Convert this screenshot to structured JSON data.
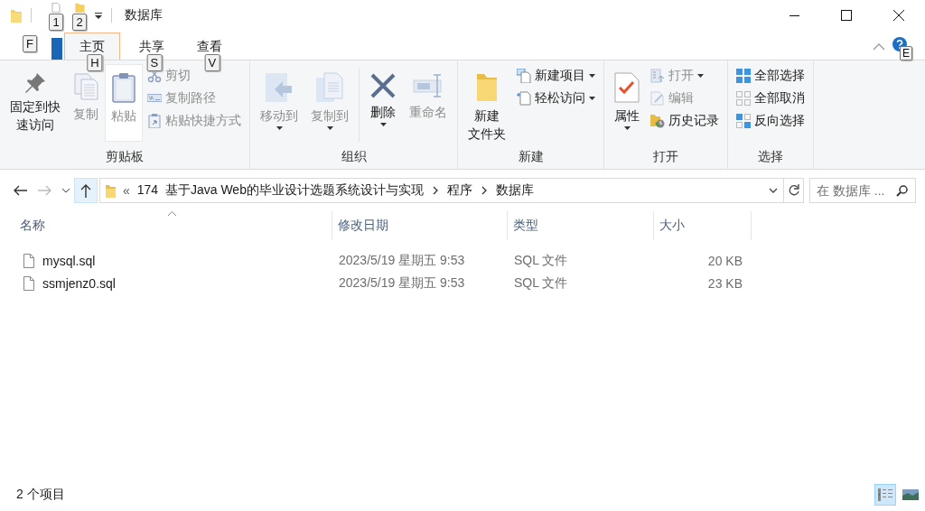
{
  "window": {
    "title": "数据库",
    "quick_access_keytips": [
      "1",
      "2"
    ]
  },
  "file_tab": {
    "keytip": "F"
  },
  "tabs": [
    {
      "label": "主页",
      "selected": true,
      "keytip": "H"
    },
    {
      "label": "共享",
      "selected": false,
      "keytip": "S"
    },
    {
      "label": "查看",
      "selected": false,
      "keytip": "V"
    }
  ],
  "help": {
    "keytip": "E"
  },
  "ribbon_groups": [
    {
      "label": "剪贴板",
      "items": [
        {
          "kind": "large",
          "lines": [
            "固定到快",
            "速访问"
          ],
          "disabled": false,
          "dropdown": false
        },
        {
          "kind": "large",
          "lines": [
            "复制"
          ],
          "disabled": true,
          "dropdown": false
        },
        {
          "kind": "large",
          "lines": [
            "粘贴"
          ],
          "disabled": true,
          "dropdown": false,
          "hovered": true
        },
        {
          "kind": "small",
          "lines": [
            "剪切"
          ],
          "disabled": true,
          "dropdown": false
        },
        {
          "kind": "small",
          "lines": [
            "复制路径"
          ],
          "disabled": true,
          "dropdown": false
        },
        {
          "kind": "small",
          "lines": [
            "粘贴快捷方式"
          ],
          "disabled": true,
          "dropdown": false
        }
      ]
    },
    {
      "label": "组织",
      "items": [
        {
          "kind": "large",
          "lines": [
            "移动到"
          ],
          "disabled": true,
          "dropdown": true
        },
        {
          "kind": "large",
          "lines": [
            "复制到"
          ],
          "disabled": true,
          "dropdown": true
        },
        {
          "kind": "large",
          "lines": [
            "删除"
          ],
          "disabled": false,
          "dropdown": true,
          "separator_before": true
        },
        {
          "kind": "large",
          "lines": [
            "重命名"
          ],
          "disabled": true,
          "dropdown": false
        }
      ]
    },
    {
      "label": "新建",
      "items": [
        {
          "kind": "large",
          "lines": [
            "新建",
            "文件夹"
          ],
          "disabled": false,
          "dropdown": false
        },
        {
          "kind": "small",
          "lines": [
            "新建项目"
          ],
          "disabled": false,
          "dropdown": true
        },
        {
          "kind": "small",
          "lines": [
            "轻松访问"
          ],
          "disabled": false,
          "dropdown": true
        }
      ]
    },
    {
      "label": "打开",
      "items": [
        {
          "kind": "large",
          "lines": [
            "属性"
          ],
          "disabled": false,
          "dropdown": true
        },
        {
          "kind": "small",
          "lines": [
            "打开"
          ],
          "disabled": true,
          "dropdown": true
        },
        {
          "kind": "small",
          "lines": [
            "编辑"
          ],
          "disabled": true,
          "dropdown": false
        },
        {
          "kind": "small",
          "lines": [
            "历史记录"
          ],
          "disabled": false,
          "dropdown": false
        }
      ]
    },
    {
      "label": "选择",
      "items": [
        {
          "kind": "small",
          "lines": [
            "全部选择"
          ],
          "disabled": false,
          "dropdown": false
        },
        {
          "kind": "small",
          "lines": [
            "全部取消"
          ],
          "disabled": false,
          "dropdown": false
        },
        {
          "kind": "small",
          "lines": [
            "反向选择"
          ],
          "disabled": false,
          "dropdown": false
        }
      ]
    }
  ],
  "navigation": {
    "back_disabled": false,
    "forward_disabled": true,
    "up_hovered": true
  },
  "address_bar": {
    "overflow": "«",
    "segments": [
      "174  基于Java Web的毕业设计选题系统设计与实现",
      "程序",
      "数据库"
    ]
  },
  "search": {
    "placeholder": "在 数据库 ..."
  },
  "table": {
    "columns": [
      {
        "label": "名称",
        "sorted": true
      },
      {
        "label": "修改日期",
        "sorted": false
      },
      {
        "label": "类型",
        "sorted": false
      },
      {
        "label": "大小",
        "sorted": false
      }
    ],
    "rows": [
      {
        "name": "mysql.sql",
        "modified": "2023/5/19 星期五 9:53",
        "type": "SQL 文件",
        "size": "20 KB"
      },
      {
        "name": "ssmjenz0.sql",
        "modified": "2023/5/19 星期五 9:53",
        "type": "SQL 文件",
        "size": "23 KB"
      }
    ]
  },
  "status_bar": {
    "item_count": "2 个项目",
    "views": [
      {
        "kind": "details",
        "selected": true
      },
      {
        "kind": "large_icons",
        "selected": false
      }
    ]
  }
}
